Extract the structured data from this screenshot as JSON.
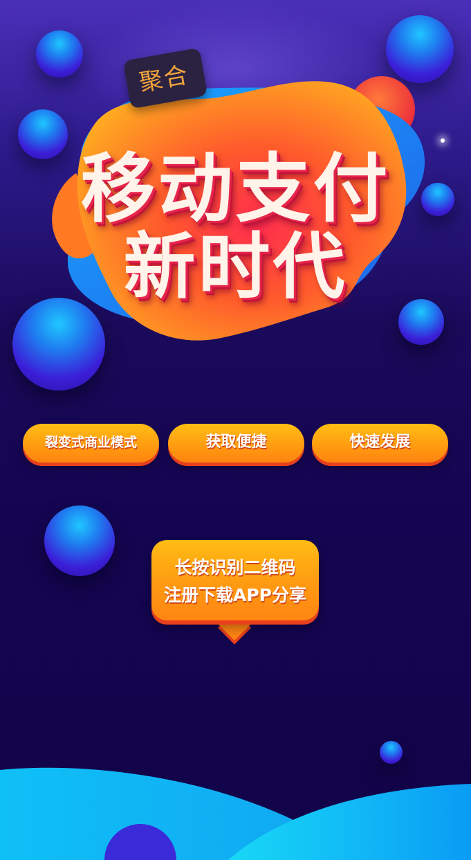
{
  "banner": {
    "tag": "聚合",
    "title_line1": "移动支付",
    "title_line2": "新时代"
  },
  "features": [
    "裂变式商业模式",
    "获取便捷",
    "快速发展"
  ],
  "cta": {
    "line1": "长按识别二维码",
    "line2": "注册下载APP分享"
  },
  "colors": {
    "background_top": "#4a2fb8",
    "background_bottom": "#120448",
    "accent_orange": "#ff9a10",
    "accent_red": "#e8254a",
    "ball_blue": "#1f7cf0",
    "wave_cyan": "#10c6f4"
  }
}
